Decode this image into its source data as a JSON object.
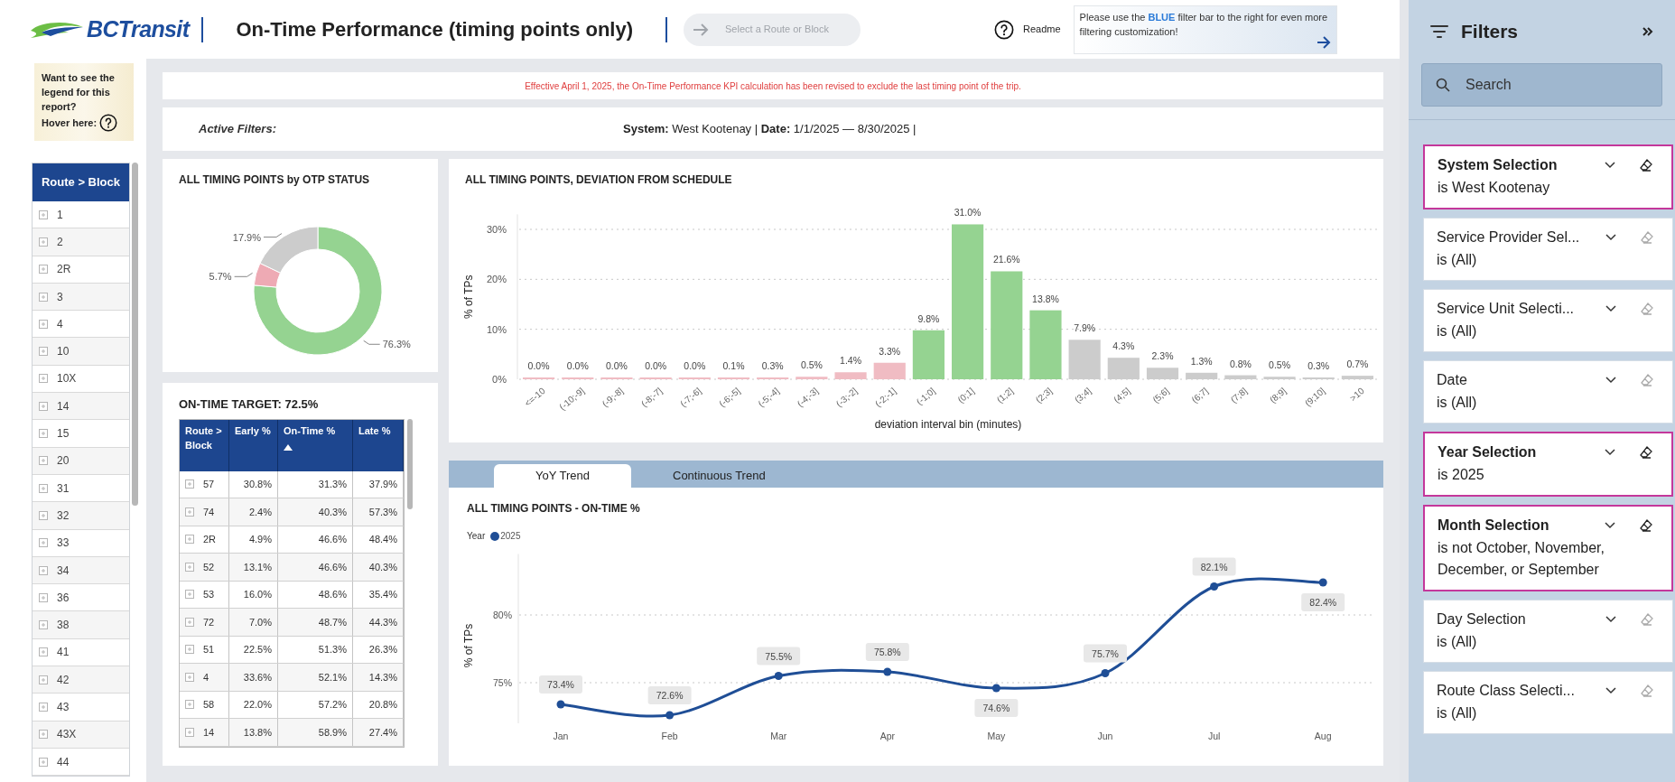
{
  "header": {
    "logo_text": "BCTransit",
    "title": "On-Time Performance (timing points only)",
    "route_button": {
      "label": "Select a Route or Block",
      "disabled": true
    },
    "readme": "Readme",
    "note": "Please use the **BLUE** filter bar to the right for even more filtering customization!"
  },
  "legend_hint": {
    "text": "Want to see the legend for this report?",
    "hover": "Hover here:"
  },
  "route_list": {
    "header": "Route > Block",
    "items": [
      "1",
      "2",
      "2R",
      "3",
      "4",
      "10",
      "10X",
      "14",
      "15",
      "20",
      "31",
      "32",
      "33",
      "34",
      "36",
      "38",
      "41",
      "42",
      "43",
      "43X",
      "44"
    ]
  },
  "banner": "Effective April 1, 2025, the On-Time Performance KPI calculation has been revised to exclude the last timing point of the trip.",
  "active_filters": {
    "label": "Active Filters:",
    "summary": "**System:** West Kootenay | **Date:** 1/1/2025 — 8/30/2025 |"
  },
  "otp_status": {
    "chart_data": {
      "type": "donut",
      "title": "ALL TIMING POINTS by OTP STATUS",
      "values": [
        76.3,
        5.7,
        17.9
      ],
      "colors": [
        "#95d391",
        "#eeaab4",
        "#cccccc"
      ],
      "value_labels": [
        "76.3%",
        "5.7%",
        "17.9%"
      ]
    }
  },
  "target_table": {
    "title": "ON-TIME TARGET: 72.5%",
    "columns": [
      {
        "label": "Route > Block",
        "sorted": false
      },
      {
        "label": "Early %",
        "sorted": false
      },
      {
        "label": "On-Time %",
        "sorted": true
      },
      {
        "label": "Late %",
        "sorted": false
      }
    ],
    "rows": [
      {
        "route": "57",
        "early": "30.8%",
        "on_time": "31.3%",
        "late": "37.9%"
      },
      {
        "route": "74",
        "early": "2.4%",
        "on_time": "40.3%",
        "late": "57.3%"
      },
      {
        "route": "2R",
        "early": "4.9%",
        "on_time": "46.6%",
        "late": "48.4%"
      },
      {
        "route": "52",
        "early": "13.1%",
        "on_time": "46.6%",
        "late": "40.3%"
      },
      {
        "route": "53",
        "early": "16.0%",
        "on_time": "48.6%",
        "late": "35.4%"
      },
      {
        "route": "72",
        "early": "7.0%",
        "on_time": "48.7%",
        "late": "44.3%"
      },
      {
        "route": "51",
        "early": "22.5%",
        "on_time": "51.3%",
        "late": "26.3%"
      },
      {
        "route": "4",
        "early": "33.6%",
        "on_time": "52.1%",
        "late": "14.3%"
      },
      {
        "route": "58",
        "early": "22.0%",
        "on_time": "57.2%",
        "late": "20.8%"
      },
      {
        "route": "14",
        "early": "13.8%",
        "on_time": "58.9%",
        "late": "27.4%"
      }
    ]
  },
  "deviation": {
    "chart_data": {
      "type": "bar",
      "title": "ALL TIMING POINTS, DEVIATION FROM SCHEDULE",
      "xlabel": "deviation interval bin (minutes)",
      "ylabel": "% of TPs",
      "categories": [
        "<=-10",
        "(-10;-9]",
        "(-9;-8]",
        "(-8;-7]",
        "(-7;-6]",
        "(-6;-5]",
        "(-5;-4]",
        "(-4;-3]",
        "(-3;-2]",
        "(-2;-1]",
        "(-1;0]",
        "(0;1]",
        "(1;2]",
        "(2;3]",
        "(3;4]",
        "(4;5]",
        "(5;6]",
        "(6;7]",
        "(7;8]",
        "(8;9]",
        "(9;10]",
        ">10"
      ],
      "values": [
        0.0,
        0.0,
        0.0,
        0.0,
        0.0,
        0.1,
        0.3,
        0.5,
        1.4,
        3.3,
        9.8,
        31.0,
        21.6,
        13.8,
        7.9,
        4.3,
        2.3,
        1.3,
        0.8,
        0.5,
        0.3,
        0.7
      ],
      "colors": [
        "#f0bcc3",
        "#f0bcc3",
        "#f0bcc3",
        "#f0bcc3",
        "#f0bcc3",
        "#f0bcc3",
        "#f0bcc3",
        "#f0bcc3",
        "#f0bcc3",
        "#f0bcc3",
        "#95d391",
        "#95d391",
        "#95d391",
        "#95d391",
        "#cccccc",
        "#cccccc",
        "#cccccc",
        "#cccccc",
        "#cccccc",
        "#cccccc",
        "#cccccc",
        "#cccccc"
      ],
      "grid": true,
      "ylim": [
        0,
        33
      ],
      "yticks": [
        {
          "value": 0,
          "label": "0%"
        },
        {
          "value": 10,
          "label": "10%"
        },
        {
          "value": 20,
          "label": "20%"
        },
        {
          "value": 30,
          "label": "30%"
        }
      ],
      "value_labels": [
        "0.0%",
        "0.0%",
        "0.0%",
        "0.0%",
        "0.0%",
        "0.1%",
        "0.3%",
        "0.5%",
        "1.4%",
        "3.3%",
        "9.8%",
        "31.0%",
        "21.6%",
        "13.8%",
        "7.9%",
        "4.3%",
        "2.3%",
        "1.3%",
        "0.8%",
        "0.5%",
        "0.3%",
        "0.7%"
      ]
    }
  },
  "trend": {
    "tabs": [
      {
        "label": "YoY Trend",
        "selected": true
      },
      {
        "label": "Continuous Trend",
        "selected": false
      }
    ],
    "chart_data": {
      "type": "line",
      "title": "ALL TIMING POINTS - ON-TIME %",
      "legend_title": "Year",
      "ylabel": "% of TPs",
      "categories": [
        "Jan",
        "Feb",
        "Mar",
        "Apr",
        "May",
        "Jun",
        "Jul",
        "Aug"
      ],
      "series": [
        {
          "name": "2025",
          "color": "#1f4e96",
          "marker": true,
          "values": [
            73.4,
            72.6,
            75.5,
            75.8,
            74.6,
            75.7,
            82.1,
            82.4
          ]
        }
      ],
      "grid": true,
      "ylim": [
        72,
        84.5
      ],
      "yticks": [
        {
          "value": 75,
          "label": "75%"
        },
        {
          "value": 80,
          "label": "80%"
        }
      ],
      "value_labels": [
        "73.4%",
        "72.6%",
        "75.5%",
        "75.8%",
        "74.6%",
        "75.7%",
        "82.1%",
        "82.4%"
      ]
    }
  },
  "filters": {
    "title": "Filters",
    "search": {
      "placeholder": "Search"
    },
    "cards": [
      {
        "title": "System Selection",
        "value": "is West Kootenay",
        "applied": true
      },
      {
        "title": "Service Provider Sel...",
        "value": "is (All)",
        "applied": false
      },
      {
        "title": "Service Unit Selecti...",
        "value": "is (All)",
        "applied": false
      },
      {
        "title": "Date",
        "value": "is (All)",
        "applied": false
      },
      {
        "title": "Year Selection",
        "value": "is 2025",
        "applied": true
      },
      {
        "title": "Month Selection",
        "value": "is not October, November, December, or September",
        "applied": true
      },
      {
        "title": "Day Selection",
        "value": "is (All)",
        "applied": false
      },
      {
        "title": "Route Class Selecti...",
        "value": "is (All)",
        "applied": false
      }
    ]
  }
}
